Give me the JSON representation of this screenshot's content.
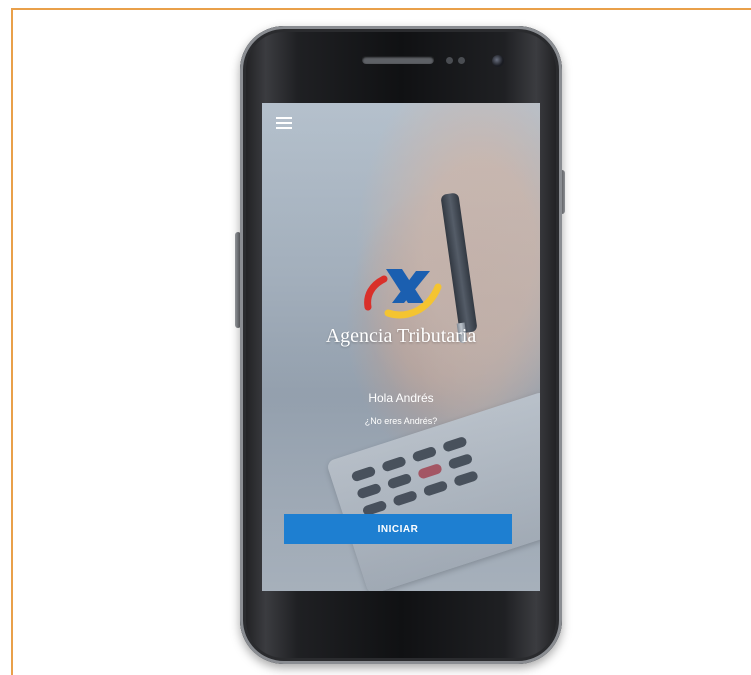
{
  "app": {
    "brand_name": "Agencia Tributaria",
    "logo_icon": "agencia-tributaria-logo",
    "menu_icon": "hamburger-menu-icon"
  },
  "login": {
    "greeting": "Hola Andrés",
    "not_user_link": "¿No eres Andrés?",
    "start_button": "INICIAR"
  },
  "colors": {
    "accent_blue": "#1e7fd1",
    "logo_red": "#d9302a",
    "logo_yellow": "#f4c431",
    "logo_blue": "#1b5fb0",
    "frame_orange": "#e9a04a"
  }
}
